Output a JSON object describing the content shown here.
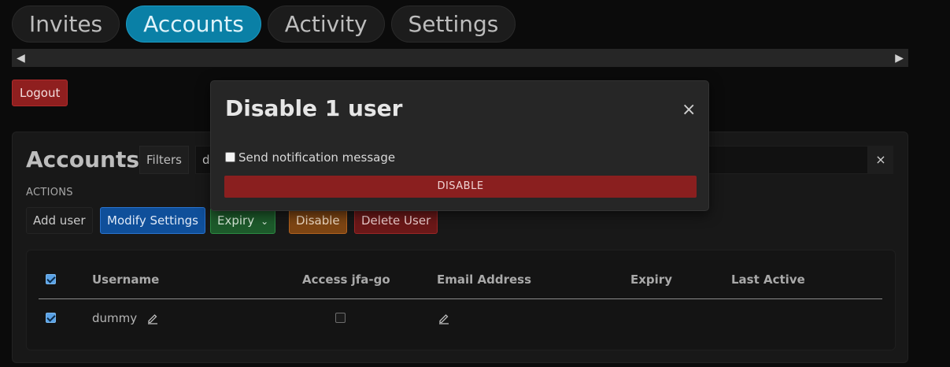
{
  "tabs": [
    {
      "label": "Invites",
      "active": false
    },
    {
      "label": "Accounts",
      "active": true
    },
    {
      "label": "Activity",
      "active": false
    },
    {
      "label": "Settings",
      "active": false
    }
  ],
  "logout_label": "Logout",
  "accounts": {
    "title": "Accounts",
    "filters_label": "Filters",
    "search_value": "dummy",
    "search_clear": "×",
    "actions_label": "ACTIONS",
    "actions": {
      "add_user": "Add user",
      "modify_settings": "Modify Settings",
      "expiry": "Expiry",
      "disable": "Disable",
      "delete_user": "Delete User"
    },
    "table": {
      "headers": [
        "Username",
        "Access jfa-go",
        "Email Address",
        "Expiry",
        "Last Active"
      ],
      "rows": [
        {
          "username": "dummy",
          "selected": true,
          "access_jfa_go": false,
          "email": "",
          "expiry": "",
          "last_active": ""
        }
      ],
      "all_selected": true
    }
  },
  "modal": {
    "title": "Disable 1 user",
    "close": "×",
    "notify_label": "Send notification message",
    "notify_checked": false,
    "button_label": "DISABLE"
  },
  "colors": {
    "accent": "#0a80a6",
    "danger": "#8a1f1f",
    "modify": "#0f4f9a",
    "expiry": "#1d5a2b",
    "disable": "#7d4513"
  }
}
